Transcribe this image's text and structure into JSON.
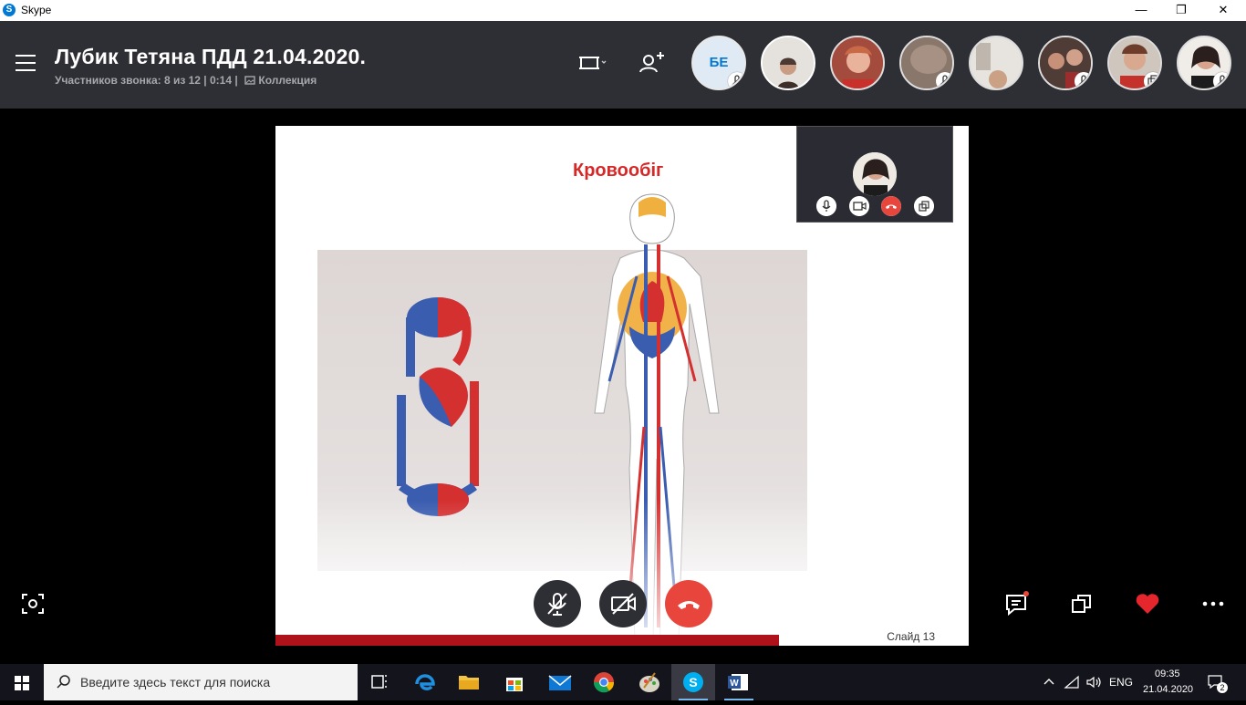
{
  "window": {
    "app_title": "Skype",
    "logo_letter": "S",
    "minimize": "—",
    "maximize": "❐",
    "close": "✕"
  },
  "call": {
    "title": "Лубик Тетяна ПДД 21.04.2020.",
    "participants_text": "Участников звонка: 8 из 12 | 0:14 |",
    "collection_label": "Коллекция"
  },
  "participants": [
    {
      "initials": "БЕ",
      "muted": true
    },
    {
      "initials": "",
      "muted": false
    },
    {
      "initials": "",
      "muted": false
    },
    {
      "initials": "",
      "muted": true
    },
    {
      "initials": "",
      "muted": false
    },
    {
      "initials": "",
      "muted": true
    },
    {
      "initials": "",
      "muted": false
    },
    {
      "initials": "",
      "muted": true
    }
  ],
  "slide": {
    "title": "Кровообіг",
    "slide_number": "Слайд 13"
  },
  "controls": {
    "mic": "microphone-off-icon",
    "video": "video-off-icon",
    "end": "end-call-icon"
  },
  "right_actions": [
    "chat-icon",
    "switch-view-icon",
    "heart-icon",
    "more-icon"
  ],
  "taskbar": {
    "search_placeholder": "Введите здесь текст для поиска",
    "lang": "ENG",
    "time": "09:35",
    "date": "21.04.2020",
    "notifications": "2"
  },
  "colors": {
    "header_bg": "#2e2e35",
    "end_call": "#e8453c",
    "slide_title": "#d72828",
    "progress": "#b0121b",
    "skype_blue": "#0078d4"
  }
}
